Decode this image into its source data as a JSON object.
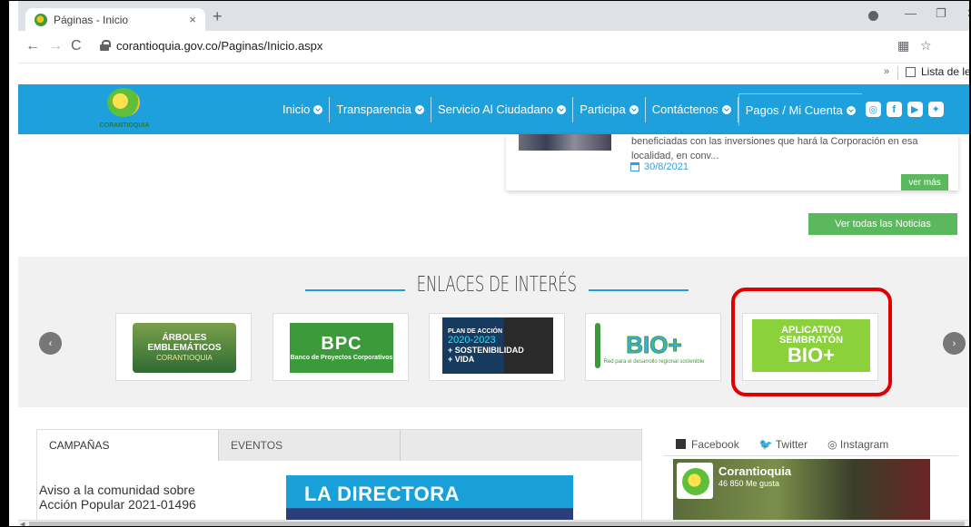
{
  "browser": {
    "tab_title": "Páginas - Inicio",
    "tab_close": "×",
    "new_tab": "+",
    "url": "corantioquia.gov.co/Paginas/Inicio.aspx",
    "bookmarks_more": "»",
    "reading_list": "Lista de lectura"
  },
  "site": {
    "logo_text": "CORANTIOQUIA",
    "nav": [
      {
        "label": "Inicio"
      },
      {
        "label": "Transparencia"
      },
      {
        "label": "Servicio Al Ciudadano"
      },
      {
        "label": "Participa"
      },
      {
        "label": "Contáctenos"
      },
      {
        "label": "Pagos / Mi Cuenta"
      }
    ],
    "social_icons": [
      "instagram-icon",
      "facebook-icon",
      "youtube-icon",
      "twitter-icon"
    ]
  },
  "news": {
    "excerpt": "beneficiadas con las inversiones que hará la Corporación en esa localidad, en conv...",
    "date": "30/8/2021",
    "more_label": "ver más",
    "all_news_label": "Ver todas las Noticias"
  },
  "links_section": {
    "title": "ENLACES DE INTERÉS",
    "prev": "‹",
    "next": "›",
    "cards": {
      "arboles": {
        "line1": "ÁRBOLES",
        "line2": "EMBLEMÁTICOS",
        "line3": "CORANTIOQUIA"
      },
      "bpc": {
        "big": "BPC",
        "small": "Banco de Proyectos Corporativos"
      },
      "plan": {
        "a": "PLAN DE ACCIÓN",
        "b": "2020-2023",
        "c": "+ SOSTENIBILIDAD",
        "d": "+ VIDA"
      },
      "bio": {
        "big": "BIO+",
        "cap": "Red para el desarrollo regional sostenible"
      },
      "sembraton": {
        "a": "APLICATIVO",
        "b": "SEMBRATÓN",
        "c": "BIO+"
      }
    }
  },
  "campaigns": {
    "tabs": [
      "CAMPAÑAS",
      "EVENTOS"
    ],
    "text_line1": "Aviso a la comunidad sobre",
    "text_line2": "Acción Popular 2021-01496",
    "image_text": "LA DIRECTORA"
  },
  "social_widget": {
    "tabs": [
      "Facebook",
      "Twitter",
      "Instagram"
    ],
    "page_name": "Corantioquia",
    "likes": "46 850 Me gusta"
  },
  "colors": {
    "nav_blue": "#1ea0dc",
    "button_green": "#5cb85c",
    "highlight_red": "#e10000"
  }
}
